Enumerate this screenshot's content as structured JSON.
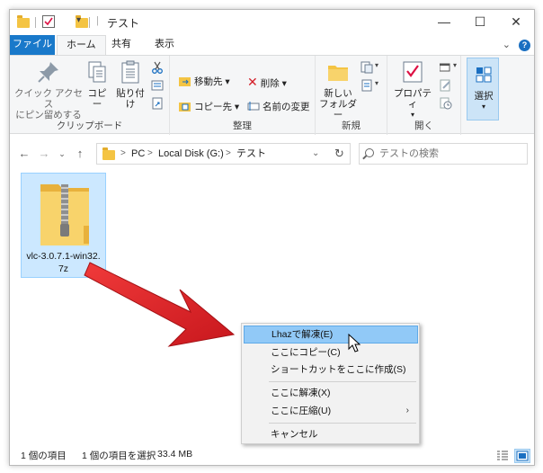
{
  "window": {
    "title": "テスト",
    "controls": {
      "minimize": "—",
      "maximize": "☐",
      "close": "✕"
    }
  },
  "ribbon": {
    "tabs": [
      "ファイル",
      "ホーム",
      "共有",
      "表示"
    ],
    "active_tab": "ホーム",
    "clipboard": {
      "pin_label_1": "クイック アクセス",
      "pin_label_2": "にピン留めする",
      "copy": "コピー",
      "paste": "貼り付け",
      "group": "クリップボード"
    },
    "organize": {
      "move_to": "移動先",
      "copy_to": "コピー先",
      "delete": "削除",
      "rename": "名前の変更",
      "group": "整理"
    },
    "new": {
      "new_folder_1": "新しい",
      "new_folder_2": "フォルダー",
      "group": "新規"
    },
    "open": {
      "properties": "プロパティ",
      "group": "開く"
    },
    "select": {
      "select": "選択"
    }
  },
  "address": {
    "crumbs": [
      "PC",
      "Local Disk (G:)",
      "テスト"
    ],
    "search_placeholder": "テストの検索"
  },
  "file": {
    "name_line1": "vlc-3.0.7.1-win32.",
    "name_line2": "7z"
  },
  "context_menu": {
    "items": [
      "Lhazで解凍(E)",
      "ここにコピー(C)",
      "ショートカットをここに作成(S)",
      "ここに解凍(X)",
      "ここに圧縮(U)",
      "キャンセル"
    ],
    "highlighted_index": 0
  },
  "status": {
    "item_count": "1 個の項目",
    "selected": "1 個の項目を選択",
    "size": "33.4 MB"
  },
  "colors": {
    "file_tab": "#1979ca",
    "selection": "#cce8ff",
    "menu_highlight": "#91c9f7",
    "arrow": "#d9262b",
    "folder": "#f4c443"
  }
}
